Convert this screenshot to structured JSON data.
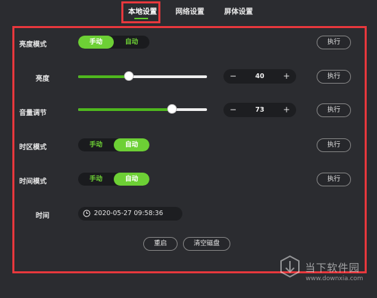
{
  "tabs": [
    {
      "label": "本地设置",
      "active": true
    },
    {
      "label": "网络设置",
      "active": false
    },
    {
      "label": "屏体设置",
      "active": false
    }
  ],
  "brightness_mode": {
    "label": "亮度模式",
    "options": [
      "手动",
      "自动"
    ],
    "selected": "手动",
    "execute": "执行"
  },
  "brightness": {
    "label": "亮度",
    "value": "40",
    "level_fraction": 0.4,
    "minus": "−",
    "plus": "+",
    "execute": "执行"
  },
  "volume": {
    "label": "音量调节",
    "value": "73",
    "level_fraction": 0.73,
    "minus": "−",
    "plus": "+",
    "execute": "执行"
  },
  "timezone_mode": {
    "label": "时区模式",
    "options": [
      "手动",
      "自动"
    ],
    "selected": "自动",
    "execute": "执行"
  },
  "time_mode": {
    "label": "时间模式",
    "options": [
      "手动",
      "自动"
    ],
    "selected": "自动",
    "execute": "执行"
  },
  "time": {
    "label": "时间",
    "value": "2020-05-27 09:58:36",
    "icon": "clock-icon"
  },
  "actions": {
    "restart": "重启",
    "clear_disk": "清空磁盘"
  },
  "watermark": {
    "text": "当下软件园",
    "url": "www.downxia.com"
  },
  "colors": {
    "accent": "#6dd035",
    "highlight": "#e8383d",
    "background": "#2b2c30"
  }
}
